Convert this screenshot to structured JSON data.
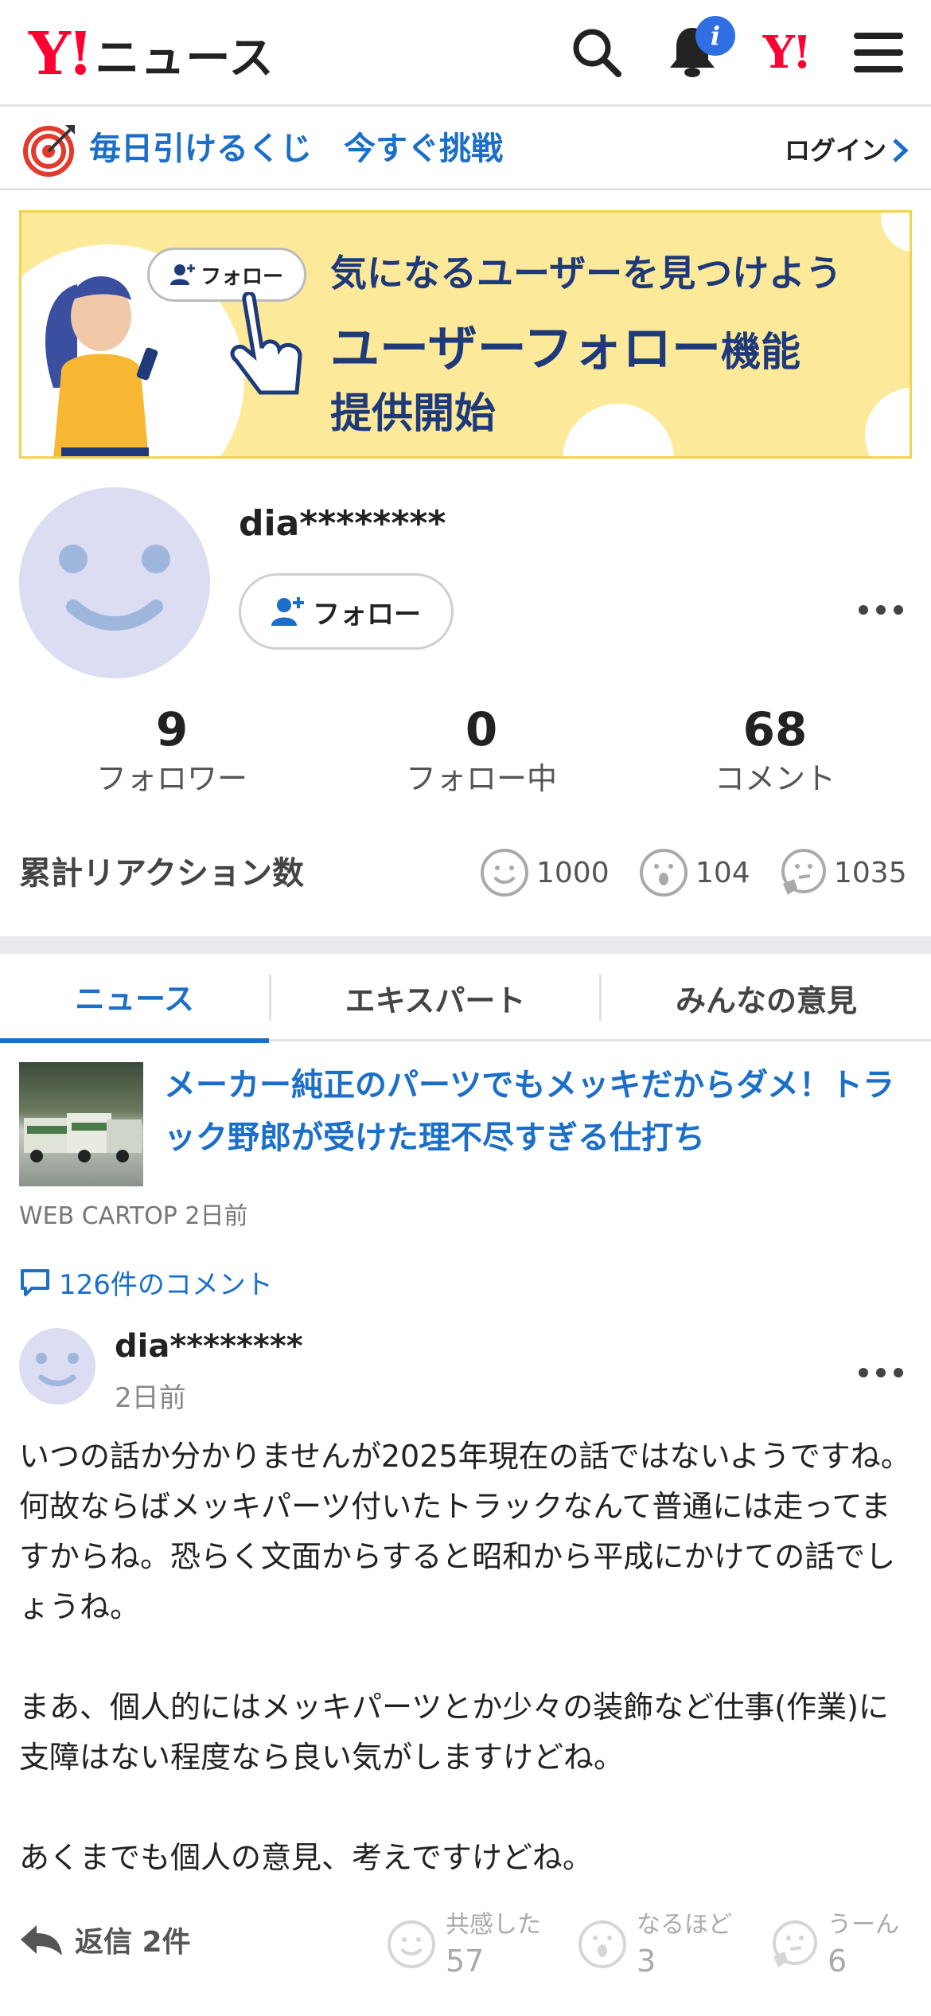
{
  "header": {
    "logo_mark": "Y!",
    "logo_text": "ニュース",
    "notification_badge": "i",
    "yahoo_mark": "Y!"
  },
  "lottery": {
    "text": "毎日引けるくじ　今すぐ挑戦",
    "login": "ログイン"
  },
  "banner": {
    "line1": "気になるユーザーを見つけよう",
    "line2_main": "ユーザーフォロー",
    "line2_suffix": "機能",
    "line3": "提供開始",
    "chip_label": "フォロー"
  },
  "profile": {
    "username": "dia********",
    "follow_label": "フォロー",
    "more": "…"
  },
  "stats": [
    {
      "value": "9",
      "label": "フォロワー"
    },
    {
      "value": "0",
      "label": "フォロー中"
    },
    {
      "value": "68",
      "label": "コメント"
    }
  ],
  "reactions": {
    "title": "累計リアクション数",
    "items": [
      {
        "icon": "smile-icon",
        "count": "1000"
      },
      {
        "icon": "surprised-icon",
        "count": "104"
      },
      {
        "icon": "thinking-icon",
        "count": "1035"
      }
    ]
  },
  "tabs": [
    {
      "label": "ニュース",
      "active": true
    },
    {
      "label": "エキスパート",
      "active": false
    },
    {
      "label": "みんなの意見",
      "active": false
    }
  ],
  "article": {
    "title": "メーカー純正のパーツでもメッキだからダメ！トラック野郎が受けた理不尽すぎる仕打ち",
    "source": "WEB CARTOP 2日前",
    "comments_link": "126件のコメント"
  },
  "comment": {
    "user": "dia********",
    "time": "2日前",
    "body": "いつの話か分かりませんが2025年現在の話ではないようですね。何故ならばメッキパーツ付いたトラックなんて普通には走ってますからね。恐らく文面からすると昭和から平成にかけての話でしょうね。\n\nまあ、個人的にはメッキパーツとか少々の装飾など仕事(作業)に支障はない程度なら良い気がしますけどね。\n\nあくまでも個人の意見、考えですけどね。",
    "reply_label": "返信 2件",
    "reactions": [
      {
        "label": "共感した",
        "count": "57"
      },
      {
        "label": "なるほど",
        "count": "3"
      },
      {
        "label": "うーん",
        "count": "6"
      }
    ]
  },
  "colors": {
    "accent_blue": "#1b6fc8",
    "yahoo_red": "#ff0033",
    "banner_yellow": "#fde99a",
    "banner_navy": "#1e3a7b"
  }
}
